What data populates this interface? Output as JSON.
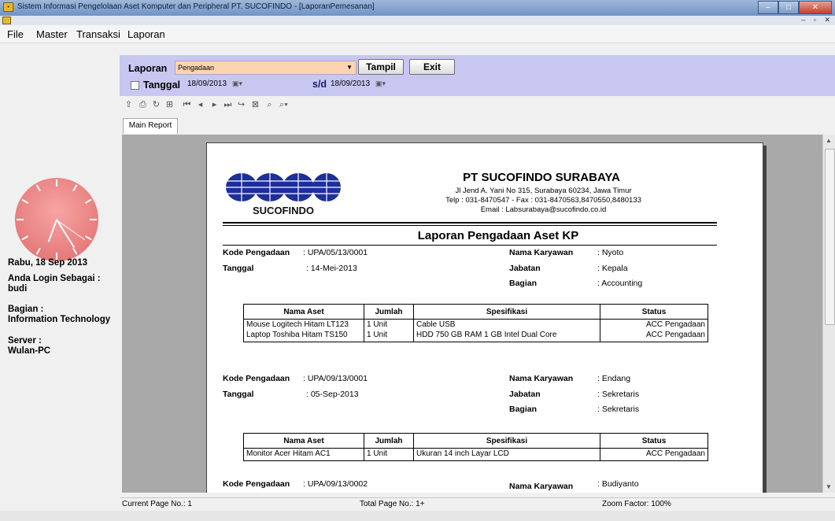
{
  "window": {
    "title": "Sistem Informasi Pengelolaan Aset Komputer dan Peripheral PT. SUCOFINDO - [LaporanPemesanan]"
  },
  "menu": [
    "File",
    "Master",
    "Transaksi",
    "Laporan"
  ],
  "sidebar": {
    "date": "Rabu, 18 Sep 2013",
    "login_label": "Anda Login Sebagai :",
    "login_user": "budi",
    "bagian_label": "Bagian :",
    "bagian_value": "Information Technology",
    "server_label": "Server :",
    "server_value": "Wulan-PC"
  },
  "filter": {
    "laporan_label": "Laporan",
    "laporan_value": "Pengadaan",
    "tampil_label": "Tampil",
    "exit_label": "Exit",
    "tanggal_label": "Tanggal",
    "date_from": "18/09/2013",
    "sd_label": "s/d",
    "date_to": "18/09/2013"
  },
  "viewer": {
    "tab_label": "Main Report"
  },
  "report": {
    "logo_text": "SUCOFINDO",
    "company": "PT SUCOFINDO SURABAYA",
    "address1": "Jl Jend A. Yani No 315, Surabaya 60234, Jawa Timur",
    "address2": "Telp : 031-8470547 - Fax : 031-8470563,8470550,8480133",
    "address3": "Email : Labsurabaya@sucofindo.co.id",
    "title": "Laporan Pengadaan Aset KP",
    "labels": {
      "kode": "Kode Pengadaan",
      "tanggal": "Tanggal",
      "nama_karyawan": "Nama Karyawan",
      "jabatan": "Jabatan",
      "bagian": "Bagian"
    },
    "columns": [
      "Nama Aset",
      "Jumlah",
      "Spesifikasi",
      "Status"
    ],
    "groups": [
      {
        "kode": ": UPA/05/13/0001",
        "tanggal": ": 14-Mei-2013",
        "nama": ": Nyoto",
        "jabatan": ": Kepala",
        "bagian": ": Accounting",
        "items": [
          {
            "nama": "Mouse Logitech Hitam LT123",
            "jumlah": "1 Unit",
            "spesifikasi": "Cable USB",
            "status": "ACC Pengadaan"
          },
          {
            "nama": "Laptop Toshiba Hitam TS150",
            "jumlah": "1 Unit",
            "spesifikasi": "HDD 750 GB RAM 1 GB Intel Dual Core",
            "status": "ACC Pengadaan"
          }
        ]
      },
      {
        "kode": ": UPA/09/13/0001",
        "tanggal": ": 05-Sep-2013",
        "nama": ": Endang",
        "jabatan": ": Sekretaris",
        "bagian": ": Sekretaris",
        "items": [
          {
            "nama": "Monitor Acer Hitam AC1",
            "jumlah": "1 Unit",
            "spesifikasi": "Ukuran 14 inch Layar LCD",
            "status": "ACC Pengadaan"
          }
        ]
      },
      {
        "kode": ": UPA/09/13/0002",
        "nama": ": Budiyanto"
      }
    ]
  },
  "status": {
    "current_page": "Current Page No.: 1",
    "total_page": "Total Page No.: 1+",
    "zoom": "Zoom Factor: 100%"
  }
}
